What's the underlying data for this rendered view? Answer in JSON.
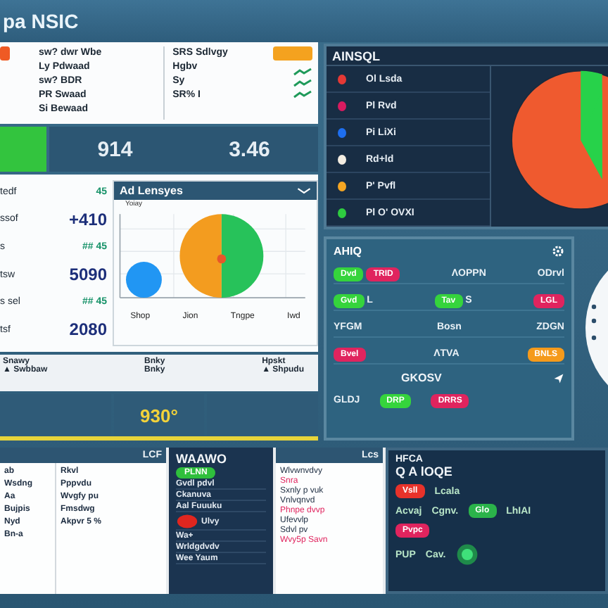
{
  "header": {
    "title": "pa NSIC"
  },
  "summary": {
    "left_lines": [
      "sw? dwr Wbe",
      "Ly Pdwaad",
      "sw? BDR",
      "PR Swaad",
      "Si Bewaad"
    ],
    "right_lines": [
      "SRS Sdlvgy",
      "Hgbv",
      "Sy",
      "SR% I"
    ]
  },
  "kpi": {
    "values": [
      "914",
      "3.46"
    ]
  },
  "metrics": [
    {
      "label": "tedf",
      "value": "45",
      "kind": "change"
    },
    {
      "label": "ssof",
      "value": "+410",
      "kind": "total"
    },
    {
      "label": "s",
      "value": "## 45",
      "kind": "change"
    },
    {
      "label": "tsw",
      "value": "5090",
      "kind": "total"
    },
    {
      "label": "s sel",
      "value": "## 45",
      "kind": "change"
    },
    {
      "label": "tsf",
      "value": "2080",
      "kind": "total"
    }
  ],
  "chart_panel": {
    "title": "Ad Lensyes",
    "axis_title": "Yoiay",
    "axis_labels": [
      "Shop",
      "Jion",
      "Tngpe",
      "Iwd"
    ]
  },
  "strip": [
    {
      "caption": "Snawy",
      "value": "▲ Swbbaw"
    },
    {
      "caption": "Bnky",
      "value": "Bnky"
    },
    {
      "caption": "Hpskt",
      "value": "▲ Shpudu"
    }
  ],
  "dial": {
    "value": "930°"
  },
  "legend_panel": {
    "title": "AINSQL",
    "items": [
      {
        "label": "Ol Lsda",
        "color": "#e53935"
      },
      {
        "label": "Pl Rvd",
        "color": "#d81b60"
      },
      {
        "label": "Pi LiXi",
        "color": "#1e6ff0"
      },
      {
        "label": "Rd+ld",
        "color": "#f3ede2"
      },
      {
        "label": "P' Pvfl",
        "color": "#f5a623"
      },
      {
        "label": "Pl O' OVXI",
        "color": "#2ecc40"
      }
    ]
  },
  "status_panel": {
    "title": "AHIQ",
    "rows": [
      [
        [
          {
            "text": "Dvd",
            "color": "#35d43c"
          },
          {
            "text": "TRID",
            "color": "#e0245e"
          }
        ],
        [
          {
            "text": "ΛOPPN"
          }
        ],
        [
          {
            "text": "ODrvl"
          }
        ]
      ],
      [
        [
          {
            "text": "Gvd",
            "color": "#35d43c"
          },
          {
            "text": "L"
          }
        ],
        [
          {
            "text": "Tav",
            "color": "#35d43c"
          },
          {
            "text": "S"
          }
        ],
        [
          {
            "text": "LGL",
            "color": "#e0245e"
          }
        ]
      ],
      [
        [
          {
            "text": "YFGM"
          }
        ],
        [
          {
            "text": "Bosn"
          }
        ],
        [
          {
            "text": "ZDGN"
          }
        ]
      ],
      [
        [
          {
            "text": "Bvel",
            "color": "#e0245e"
          }
        ],
        [
          {
            "text": "ΛTVA"
          }
        ],
        [
          {
            "text": "BNLS",
            "color": "#f59a1b"
          }
        ]
      ]
    ],
    "footer": "GKOSV",
    "bottom": [
      {
        "text": "GLDJ"
      },
      {
        "text": "DRP",
        "color": "#35d43c"
      },
      {
        "text": "DRRS",
        "color": "#e0245e"
      }
    ]
  },
  "cards": [
    {
      "kind": "columns",
      "title": "LCF",
      "left": [
        "ab",
        "Wsdng",
        "Aa",
        "Bujpis",
        "Nyd",
        "Bn-a"
      ],
      "right": [
        "Rkvl",
        "Pppvdu",
        "Wvgfy pu",
        "Fmsdwg",
        "Akpvr 5 %"
      ]
    },
    {
      "kind": "list",
      "title": "WAAWO",
      "chip": "PLNN",
      "lines": [
        "Gvdl pdvl",
        "Ckanuva",
        "Aal Fuuuku",
        "Ulvy",
        "Wa+",
        "Wrldgdvdv",
        "Wee Yaum"
      ]
    },
    {
      "kind": "notes",
      "title": "Lcs",
      "lines": [
        "Wlvwnvdvy",
        "Snra",
        "Sxnly p vuk",
        "Vnlvqnvd",
        "Phnpe dvvp",
        "Ufevvlp",
        "Sdvl pv",
        "Wvy5p Savn"
      ]
    },
    {
      "kind": "board",
      "title": "HFCA",
      "subtitle": "Q A lOQE",
      "rows": [
        [
          {
            "text": "Vsll",
            "color": "#e8322a"
          },
          {
            "text": "Lcala"
          }
        ],
        [
          {
            "text": "Acvaj"
          },
          {
            "text": "Cgnv."
          },
          {
            "text": "Glo",
            "color": "#2bb34a"
          },
          {
            "text": "LhIAI"
          }
        ],
        [
          {
            "text": "Pvpc",
            "color": "#e0245e"
          }
        ],
        [
          {
            "text": "PUP"
          },
          {
            "text": "Cav."
          }
        ]
      ]
    }
  ]
}
